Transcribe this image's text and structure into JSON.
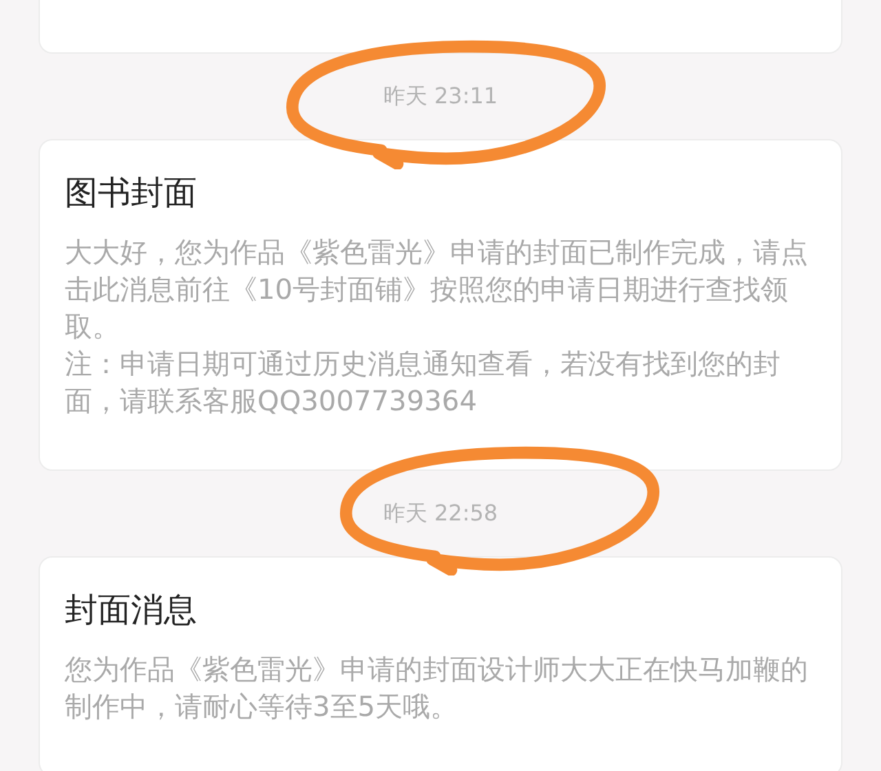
{
  "messages": [
    {
      "time": "昨天 23:11",
      "circled": true,
      "title": "图书封面",
      "paragraphs": [
        "大大好，您为作品《紫色雷光》申请的封面已制作完成，请点击此消息前往《10号封面铺》按照您的申请日期进行查找领取。",
        "注：申请日期可通过历史消息通知查看，若没有找到您的封面，请联系客服QQ3007739364"
      ]
    },
    {
      "time": "昨天 22:58",
      "circled": true,
      "title": "封面消息",
      "paragraphs": [
        "您为作品《紫色雷光》申请的封面设计师大大正在快马加鞭的制作中，请耐心等待3至5天哦。"
      ]
    }
  ]
}
